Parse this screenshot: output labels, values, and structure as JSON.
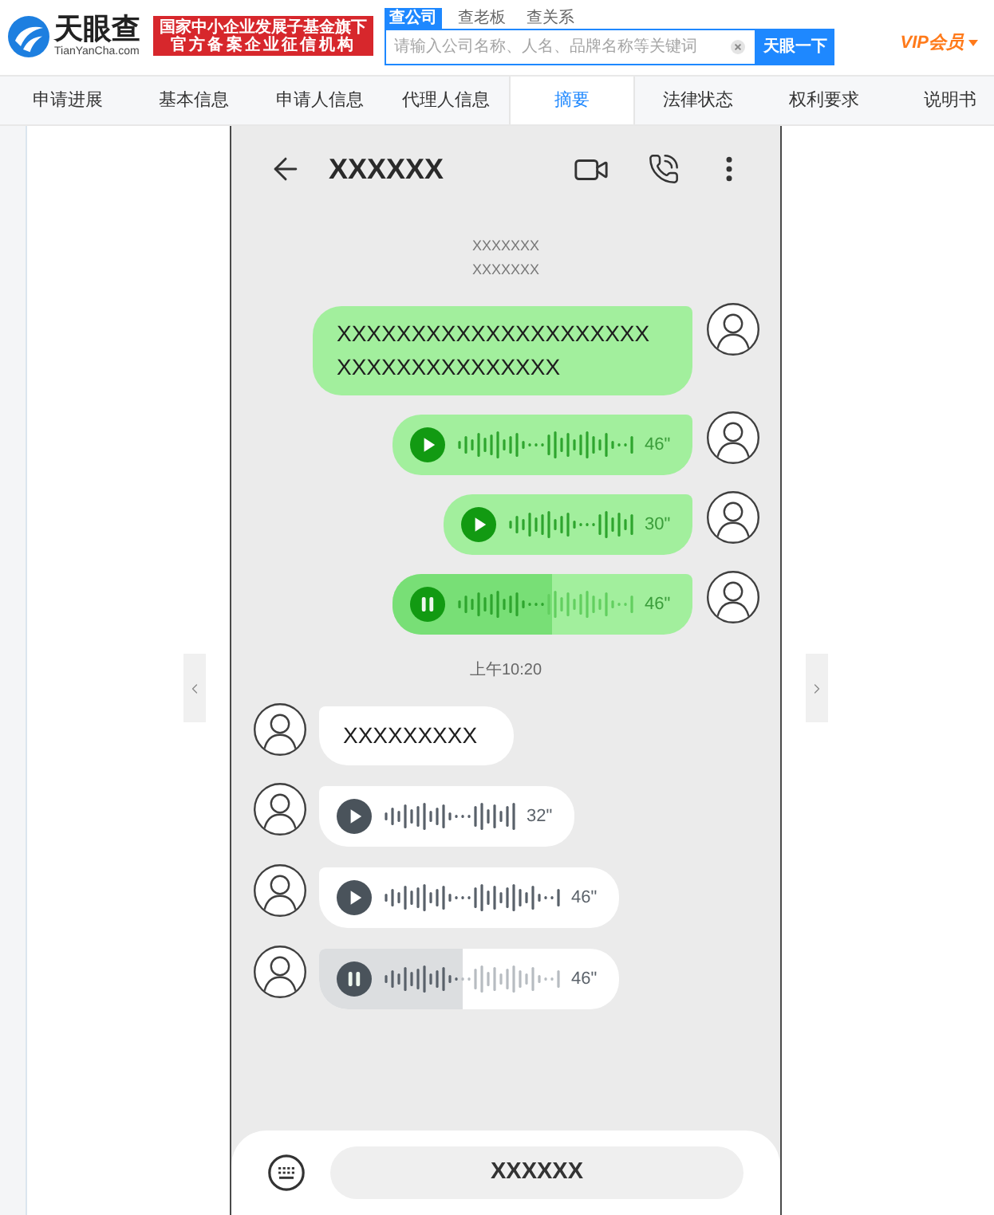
{
  "header": {
    "logo": {
      "name": "天眼查",
      "domain": "TianYanCha.com"
    },
    "badge_lines": [
      "国家中小企业发展子基金旗下",
      "官方备案企业征信机构"
    ],
    "search": {
      "tabs": [
        {
          "label": "查公司",
          "selected": true
        },
        {
          "label": "查老板",
          "selected": false
        },
        {
          "label": "查关系",
          "selected": false
        }
      ],
      "placeholder": "请输入公司名称、人名、品牌名称等关键词",
      "button": "天眼一下"
    },
    "vip": "VIP会员"
  },
  "nav_tabs": [
    {
      "label": "申请进展",
      "selected": false
    },
    {
      "label": "基本信息",
      "selected": false
    },
    {
      "label": "申请人信息",
      "selected": false
    },
    {
      "label": "代理人信息",
      "selected": false
    },
    {
      "label": "摘要",
      "selected": true
    },
    {
      "label": "法律状态",
      "selected": false
    },
    {
      "label": "权利要求",
      "selected": false
    },
    {
      "label": "说明书",
      "selected": false
    }
  ],
  "phone": {
    "title": "XXXXXX",
    "date_lines": [
      "XXXXXXX",
      "XXXXXXX"
    ],
    "messages": [
      {
        "kind": "text",
        "outgoing": true,
        "text": "XXXXXXXXXXXXXXXXXXXXXXXXXXXXXXXXXXXX"
      },
      {
        "kind": "voice",
        "outgoing": true,
        "duration": "46\"",
        "playing": false
      },
      {
        "kind": "voice",
        "outgoing": true,
        "duration": "30\"",
        "playing": false
      },
      {
        "kind": "voice",
        "outgoing": true,
        "duration": "46\"",
        "playing": true,
        "level": 0.53
      },
      {
        "kind": "time",
        "text": "上午10:20"
      },
      {
        "kind": "text",
        "outgoing": false,
        "text": "XXXXXXXXX"
      },
      {
        "kind": "voice",
        "outgoing": false,
        "duration": "32\"",
        "playing": false
      },
      {
        "kind": "voice",
        "outgoing": false,
        "duration": "46\"",
        "playing": false
      },
      {
        "kind": "voice",
        "outgoing": false,
        "duration": "46\"",
        "playing": true,
        "level": 0.48
      }
    ],
    "input_button": "XXXXXX"
  }
}
